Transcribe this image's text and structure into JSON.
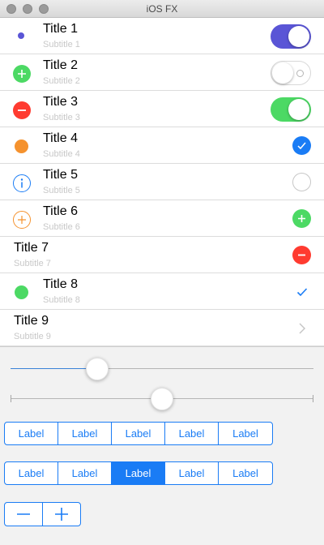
{
  "window": {
    "title": "iOS FX"
  },
  "colors": {
    "accent": "#1a7cf5",
    "switch_on_purple": "#5a55d6",
    "switch_on_green": "#4cd964",
    "green": "#4cd964",
    "red": "#ff3b30",
    "orange": "#f5922e"
  },
  "list": {
    "rows": [
      {
        "title": "Title 1",
        "subtitle": "Subtitle 1",
        "leading_icon": "dot-icon",
        "trailing": "switch",
        "switch_on": true,
        "switch_color": "purple"
      },
      {
        "title": "Title 2",
        "subtitle": "Subtitle 2",
        "leading_icon": "plus-circle-icon",
        "trailing": "switch",
        "switch_on": false
      },
      {
        "title": "Title 3",
        "subtitle": "Subtitle 3",
        "leading_icon": "minus-circle-icon",
        "trailing": "switch",
        "switch_on": true,
        "switch_color": "green"
      },
      {
        "title": "Title 4",
        "subtitle": "Subtitle 4",
        "leading_icon": "dot-icon",
        "trailing": "checkmark-circle-icon"
      },
      {
        "title": "Title 5",
        "subtitle": "Subtitle 5",
        "leading_icon": "info-icon",
        "trailing": "empty-circle-icon"
      },
      {
        "title": "Title 6",
        "subtitle": "Subtitle 6",
        "leading_icon": "plus-outline-icon",
        "trailing": "plus-circle-icon"
      },
      {
        "title": "Title 7",
        "subtitle": "Subtitle 7",
        "leading_icon": null,
        "trailing": "minus-circle-icon"
      },
      {
        "title": "Title 8",
        "subtitle": "Subtitle 8",
        "leading_icon": "dot-icon",
        "trailing": "checkmark-icon"
      },
      {
        "title": "Title 9",
        "subtitle": "Subtitle 9",
        "leading_icon": null,
        "trailing": "chevron-right-icon"
      }
    ]
  },
  "sliders": [
    {
      "value": 0.27,
      "ticks": false
    },
    {
      "value": 0.5,
      "ticks": true
    }
  ],
  "segmented": [
    {
      "labels": [
        "Label",
        "Label",
        "Label",
        "Label",
        "Label"
      ],
      "selected_index": null
    },
    {
      "labels": [
        "Label",
        "Label",
        "Label",
        "Label",
        "Label"
      ],
      "selected_index": 2
    }
  ],
  "stepper": {
    "minus_icon": "minus-icon",
    "plus_icon": "plus-icon"
  }
}
